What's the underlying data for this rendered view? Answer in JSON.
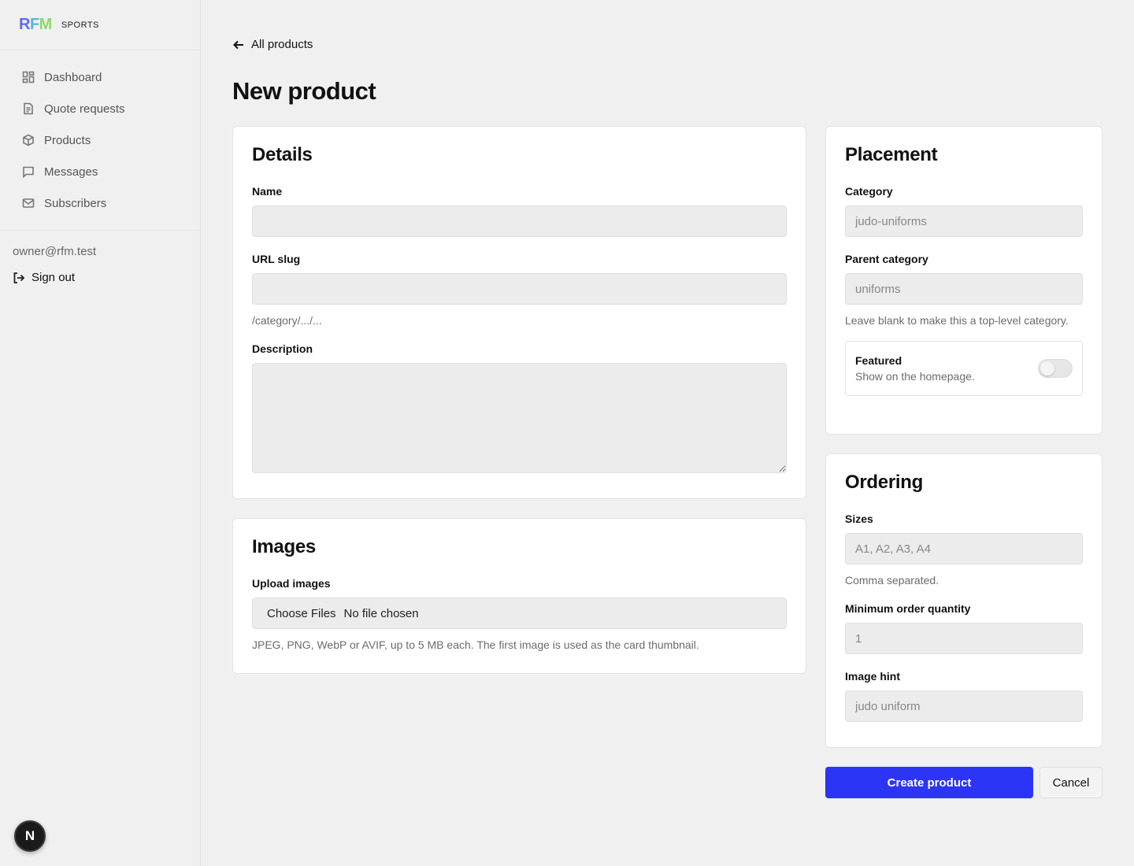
{
  "brand": {
    "letters": [
      "R",
      "F",
      "M"
    ],
    "subtitle": "SPORTS"
  },
  "sidebar": {
    "items": [
      {
        "label": "Dashboard",
        "icon": "grid-icon"
      },
      {
        "label": "Quote requests",
        "icon": "document-icon"
      },
      {
        "label": "Products",
        "icon": "box-icon"
      },
      {
        "label": "Messages",
        "icon": "message-icon"
      },
      {
        "label": "Subscribers",
        "icon": "mail-icon"
      }
    ],
    "user_email": "owner@rfm.test",
    "signout_label": "Sign out",
    "badge": "N"
  },
  "header": {
    "back_label": "All products",
    "title": "New product"
  },
  "details": {
    "title": "Details",
    "name_label": "Name",
    "name_value": "",
    "slug_label": "URL slug",
    "slug_value": "",
    "slug_help": "/category/.../...",
    "description_label": "Description",
    "description_value": ""
  },
  "images": {
    "title": "Images",
    "upload_label": "Upload images",
    "choose_button": "Choose Files",
    "file_status": "No file chosen",
    "help": "JPEG, PNG, WebP or AVIF, up to 5 MB each. The first image is used as the card thumbnail."
  },
  "placement": {
    "title": "Placement",
    "category_label": "Category",
    "category_placeholder": "judo-uniforms",
    "parent_label": "Parent category",
    "parent_placeholder": "uniforms",
    "parent_help": "Leave blank to make this a top-level category.",
    "featured_title": "Featured",
    "featured_sub": "Show on the homepage.",
    "featured_on": false
  },
  "ordering": {
    "title": "Ordering",
    "sizes_label": "Sizes",
    "sizes_placeholder": "A1, A2, A3, A4",
    "sizes_help": "Comma separated.",
    "moq_label": "Minimum order quantity",
    "moq_placeholder": "1",
    "hint_label": "Image hint",
    "hint_placeholder": "judo uniform"
  },
  "actions": {
    "create_label": "Create product",
    "cancel_label": "Cancel"
  },
  "colors": {
    "primary": "#2c35f5",
    "brand_r": "#5b6cf0",
    "brand_f": "#57b6d8",
    "brand_m": "#8ed86a"
  }
}
